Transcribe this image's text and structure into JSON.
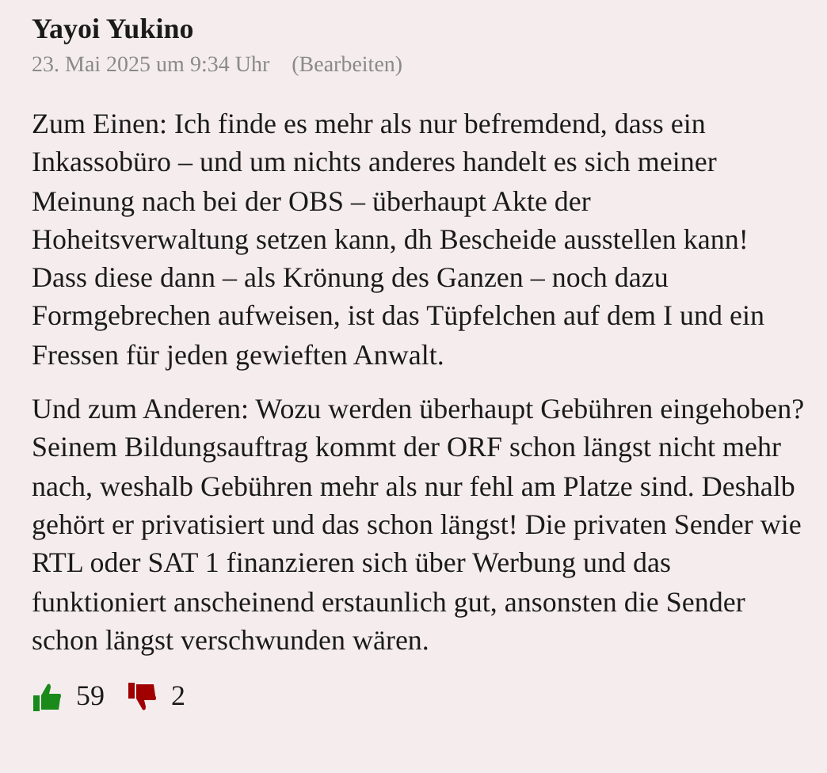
{
  "comment": {
    "author": "Yayoi Yukino",
    "date": "23. Mai 2025 um 9:34 Uhr",
    "edit_link": "(Bearbeiten)",
    "paragraphs": [
      "Zum Einen: Ich finde es mehr als nur befremdend, dass ein Inkassobüro – und um nichts anderes handelt es sich meiner Meinung nach bei der OBS – überhaupt Akte der Hoheitsverwaltung setzen kann, dh Bescheide ausstellen kann! Dass diese dann – als Krönung des Ganzen – noch dazu Formgebrechen aufweisen, ist das Tüpfelchen auf dem I und ein Fressen für jeden gewieften Anwalt.",
      "Und zum Anderen: Wozu werden überhaupt Gebühren eingehoben? Seinem Bildungsauftrag kommt der ORF schon längst nicht mehr nach, weshalb Gebühren mehr als nur fehl am Platze sind. Deshalb gehört er privatisiert und das schon längst! Die privaten Sender wie RTL oder SAT 1 finanzieren sich über Werbung und das funktioniert anscheinend erstaunlich gut, ansonsten die Sender schon längst verschwunden wären."
    ],
    "likes": "59",
    "dislikes": "2"
  }
}
